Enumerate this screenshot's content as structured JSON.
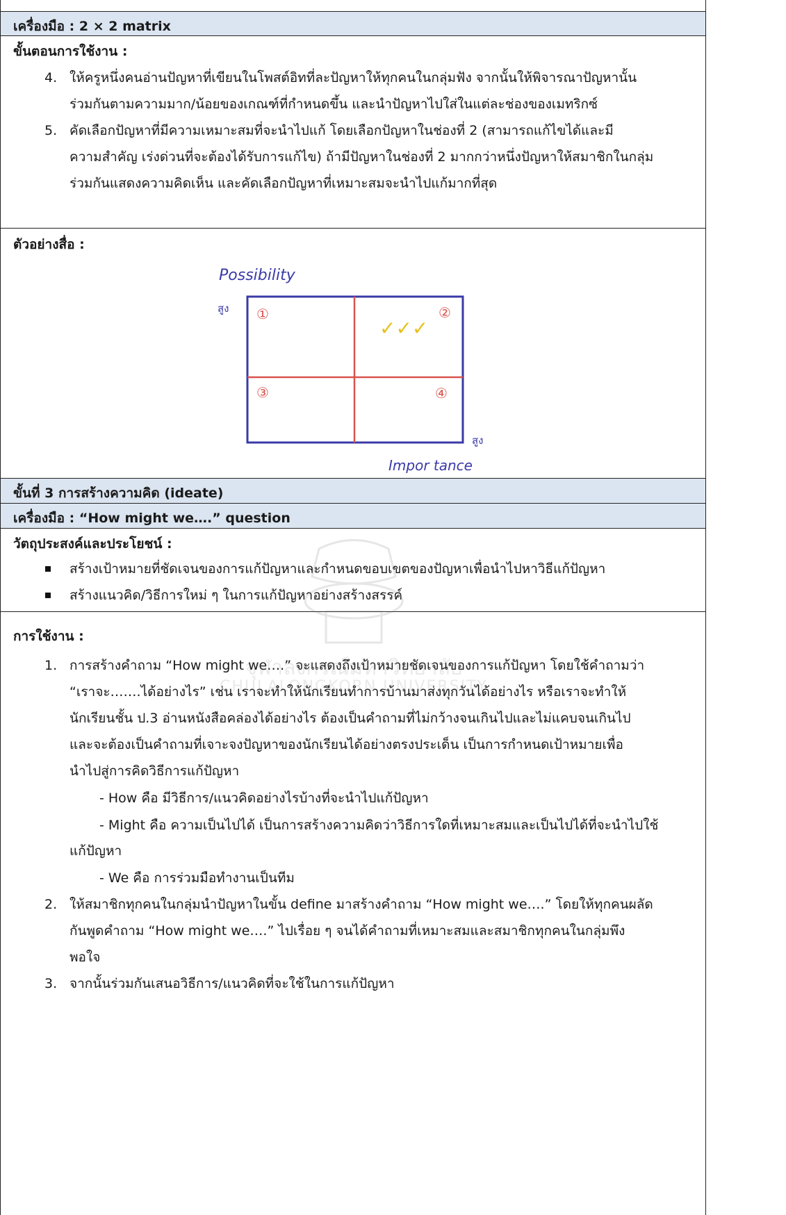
{
  "section1": {
    "tool_label": "เครื่องมือ : 2 × 2 matrix",
    "steps_label": "ขั้นตอนการใช้งาน :",
    "steps": [
      {
        "num": "4.",
        "lines": [
          "ให้ครูหนึ่งคนอ่านปัญหาที่เขียนในโพสต์อิทที่ละปัญหาให้ทุกคนในกลุ่มฟัง จากนั้นให้พิจารณาปัญหานั้น",
          "ร่วมกันตามความมาก/น้อยของเกณฑ์ที่กำหนดขึ้น และนำปัญหาไปใส่ในแต่ละช่องของเมทริกซ์"
        ]
      },
      {
        "num": "5.",
        "lines": [
          "คัดเลือกปัญหาที่มีความเหมาะสมที่จะนำไปแก้ โดยเลือกปัญหาในช่องที่ 2 (สามารถแก้ไขได้และมี",
          "ความสำคัญ เร่งด่วนที่จะต้องได้รับการแก้ไข) ถ้ามีปัญหาในช่องที่ 2 มากกว่าหนึ่งปัญหาให้สมาชิกในกลุ่ม",
          "ร่วมกันแสดงความคิดเห็น และคัดเลือกปัญหาที่เหมาะสมจะนำไปแก้มากที่สุด"
        ]
      }
    ],
    "example_label": "ตัวอย่างสื่อ :",
    "matrix": {
      "y_axis_title": "Possibility",
      "y_axis_high": "สูง",
      "x_axis_title": "Impor tance",
      "x_axis_high": "สูง",
      "quadrant_labels": [
        "①",
        "②",
        "③",
        "④"
      ],
      "checkmarks": "✓✓✓",
      "colors": {
        "frame": "#3a3aa8",
        "divider": "#d9534f",
        "check": "#e6c21f",
        "axis_text": "#3a3aa8"
      }
    }
  },
  "section2": {
    "stage_label": "ขั้นที่ 3 การสร้างความคิด (ideate)",
    "tool_label": "เครื่องมือ : “How might we….” question",
    "objective_label": "วัตถุประสงค์และประโยชน์ :",
    "objectives": [
      "สร้างเป้าหมายที่ชัดเจนของการแก้ปัญหาและกำหนดขอบเขตของปัญหาเพื่อนำไปหาวิธีแก้ปัญหา",
      "สร้างแนวคิด/วิธีการใหม่ ๆ ในการแก้ปัญหาอย่างสร้างสรรค์"
    ],
    "usage_label": "การใช้งาน :",
    "usage": [
      {
        "num": "1.",
        "lines": [
          "การสร้างคำถาม “How might we….” จะแสดงถึงเป้าหมายชัดเจนของการแก้ปัญหา โดยใช้คำถามว่า",
          "“เราจะ…….ได้อย่างไร” เช่น เราจะทำให้นักเรียนทำการบ้านมาส่งทุกวันได้อย่างไร หรือเราจะทำให้",
          "นักเรียนชั้น ป.3 อ่านหนังสือคล่องได้อย่างไร ต้องเป็นคำถามที่ไม่กว้างจนเกินไปและไม่แคบจนเกินไป",
          "และจะต้องเป็นคำถามที่เจาะจงปัญหาของนักเรียนได้อย่างตรงประเด็น เป็นการกำหนดเป้าหมายเพื่อ",
          "นำไปสู่การคิดวิธีการแก้ปัญหา"
        ]
      },
      {
        "num": "2.",
        "lines": [
          "ให้สมาชิกทุกคนในกลุ่มนำปัญหาในขั้น define มาสร้างคำถาม “How might we….” โดยให้ทุกคนผลัด",
          "กันพูดคำถาม “How might we….” ไปเรื่อย ๆ จนได้คำถามที่เหมาะสมและสมาชิกทุกคนในกลุ่มพึง",
          "พอใจ"
        ]
      },
      {
        "num": "3.",
        "lines": [
          "จากนั้นร่วมกันเสนอวิธีการ/แนวคิดที่จะใช้ในการแก้ปัญหา"
        ]
      }
    ],
    "how_items": [
      "- How คือ มีวิธีการ/แนวคิดอย่างไรบ้างที่จะนำไปแก้ปัญหา",
      "- Might คือ ความเป็นไปได้ เป็นการสร้างความคิดว่าวิธีการใดที่เหมาะสมและเป็นไปได้ที่จะนำไปใช้",
      "แก้ปัญหา",
      "- We คือ การร่วมมือทำงานเป็นทีม"
    ]
  },
  "watermark": {
    "thai": "จุฬาลงกรณ์มหาวิทยาลัย",
    "english": "CHULALONGKORN UNIVERSITY"
  }
}
